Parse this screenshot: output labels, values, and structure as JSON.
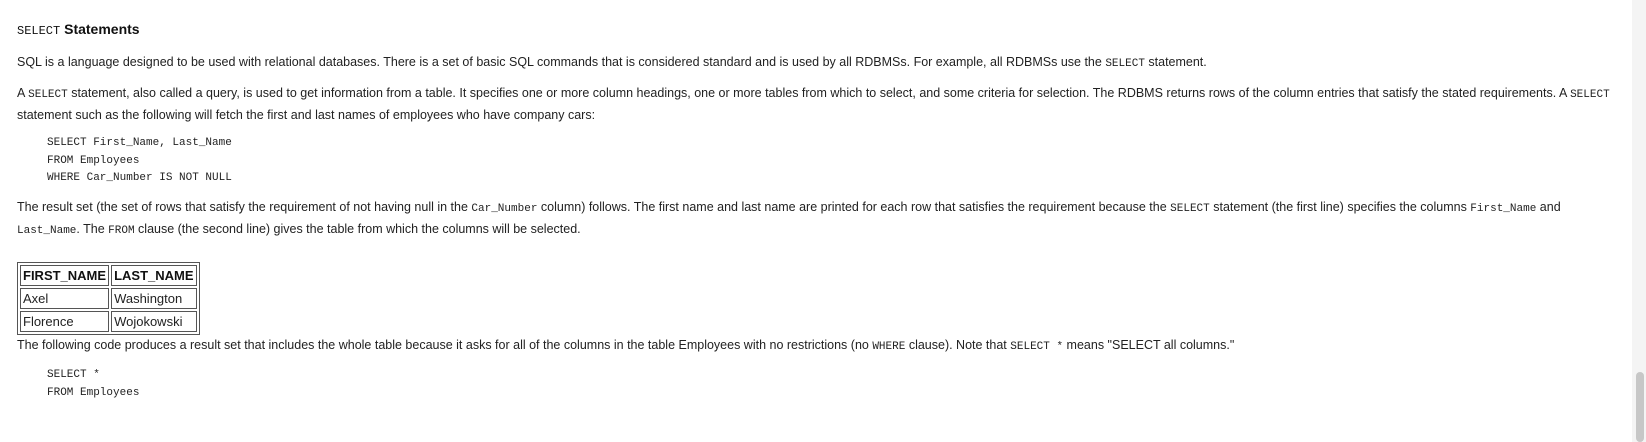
{
  "heading": {
    "code": "SELECT",
    "text": "Statements"
  },
  "para1": {
    "t1": "SQL is a language designed to be used with relational databases. There is a set of basic SQL commands that is considered standard and is used by all RDBMSs. For example, all RDBMSs use the ",
    "c1": "SELECT",
    "t2": " statement."
  },
  "para2": {
    "t1": "A ",
    "c1": "SELECT",
    "t2": " statement, also called a query, is used to get information from a table. It specifies one or more column headings, one or more tables from which to select, and some criteria for selection. The RDBMS returns rows of the column entries that satisfy the stated requirements. A ",
    "c2": "SELECT",
    "t3": " statement such as the following will fetch the first and last names of employees who have company cars:"
  },
  "code1": "SELECT First_Name, Last_Name\nFROM Employees\nWHERE Car_Number IS NOT NULL",
  "para3": {
    "t1": "The result set (the set of rows that satisfy the requirement of not having null in the ",
    "c1": "Car_Number",
    "t2": " column) follows. The first name and last name are printed for each row that satisfies the requirement because the ",
    "c2": "SELECT",
    "t3": " statement (the first line) specifies the columns ",
    "c3": "First_Name",
    "t4": " and ",
    "c4": "Last_Name",
    "t5": ". The ",
    "c5": "FROM",
    "t6": " clause (the second line) gives the table from which the columns will be selected."
  },
  "result_table": {
    "headers": [
      "FIRST_NAME",
      "LAST_NAME"
    ],
    "rows": [
      [
        "Axel",
        "Washington"
      ],
      [
        "Florence",
        "Wojokowski"
      ]
    ]
  },
  "para4": {
    "t1": "The following code produces a result set that includes the whole table because it asks for all of the columns in the table Employees with no restrictions (no ",
    "c1": "WHERE",
    "t2": " clause). Note that ",
    "c2": "SELECT *",
    "t3": " means \"SELECT all columns.\""
  },
  "code2": "SELECT *\nFROM Employees"
}
